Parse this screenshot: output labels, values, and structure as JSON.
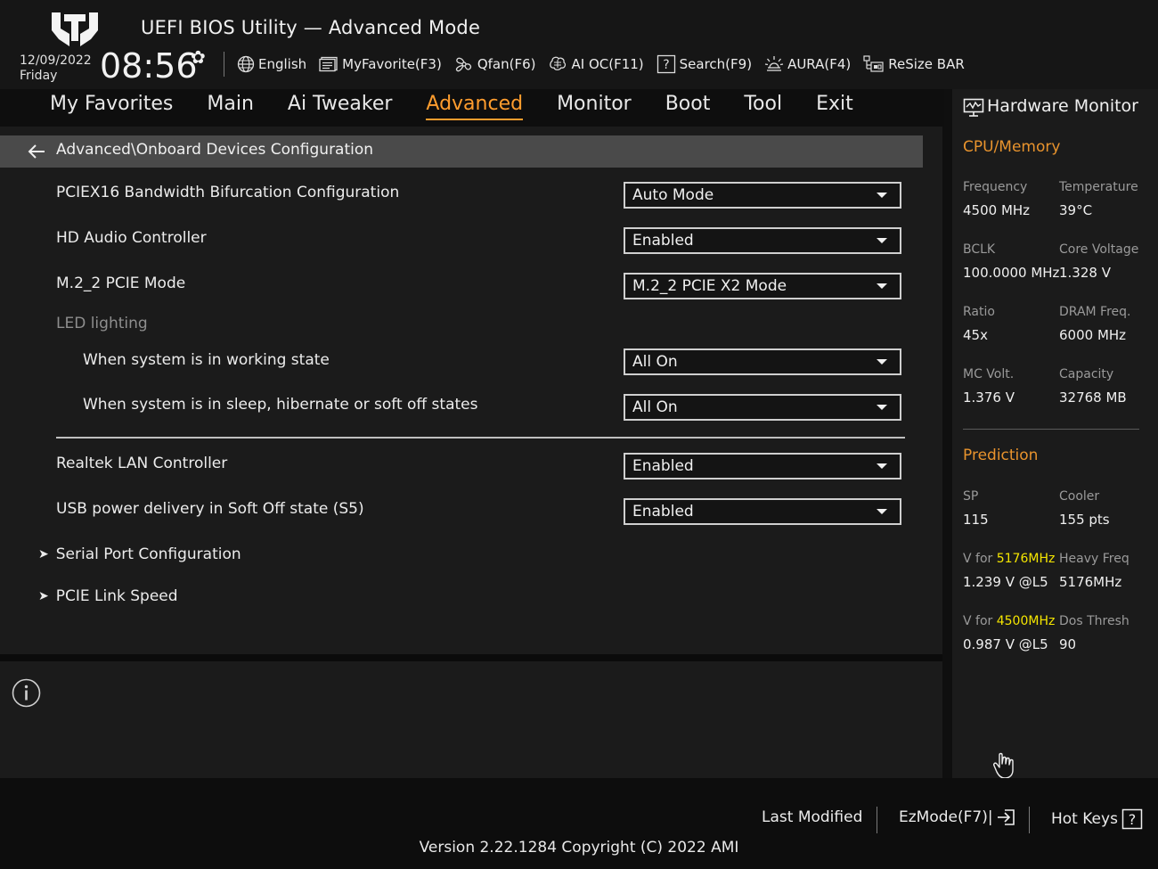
{
  "header": {
    "title": "UEFI BIOS Utility — Advanced Mode",
    "date": "12/09/2022",
    "day": "Friday",
    "time": "08:56",
    "toolbar": [
      {
        "label": "English",
        "icon": "globe-icon"
      },
      {
        "label": "MyFavorite(F3)",
        "icon": "favorite-list-icon"
      },
      {
        "label": "Qfan(F6)",
        "icon": "fan-icon"
      },
      {
        "label": "AI OC(F11)",
        "icon": "ai-chip-icon"
      },
      {
        "label": "Search(F9)",
        "icon": "search-help-icon"
      },
      {
        "label": "AURA(F4)",
        "icon": "aura-light-icon"
      },
      {
        "label": "ReSize BAR",
        "icon": "resize-bar-icon"
      }
    ]
  },
  "tabs": [
    "My Favorites",
    "Main",
    "Ai Tweaker",
    "Advanced",
    "Monitor",
    "Boot",
    "Tool",
    "Exit"
  ],
  "active_tab": "Advanced",
  "breadcrumb": "Advanced\\Onboard Devices Configuration",
  "settings": [
    {
      "label": "PCIEX16 Bandwidth Bifurcation Configuration",
      "value": "Auto Mode"
    },
    {
      "label": "HD Audio Controller",
      "value": "Enabled"
    },
    {
      "label": "M.2_2 PCIE Mode",
      "value": "M.2_2 PCIE X2 Mode"
    },
    {
      "label": "LED lighting"
    },
    {
      "label": "When system is in working state",
      "value": "All On"
    },
    {
      "label": "When system is in sleep, hibernate or soft off states",
      "value": "All On"
    },
    {
      "label": "Realtek LAN Controller",
      "value": "Enabled"
    },
    {
      "label": "USB power delivery in Soft Off state (S5)",
      "value": "Enabled"
    }
  ],
  "submenus": [
    "Serial Port Configuration",
    "PCIE Link Speed"
  ],
  "hw": {
    "title": "Hardware Monitor",
    "cpu_section": "CPU/Memory",
    "cpu": [
      {
        "label": "Frequency",
        "value": "4500 MHz"
      },
      {
        "label": "Temperature",
        "value": "39°C"
      },
      {
        "label": "BCLK",
        "value": "100.0000 MHz"
      },
      {
        "label": "Core Voltage",
        "value": "1.328 V"
      },
      {
        "label": "Ratio",
        "value": "45x"
      },
      {
        "label": "DRAM Freq.",
        "value": "6000 MHz"
      },
      {
        "label": "MC Volt.",
        "value": "1.376 V"
      },
      {
        "label": "Capacity",
        "value": "32768 MB"
      }
    ],
    "pred_section": "Prediction",
    "pred": [
      {
        "label": "SP",
        "value": "115"
      },
      {
        "label": "Cooler",
        "value": "155 pts"
      },
      {
        "label_pre": "V for ",
        "label_hl": "5176MHz",
        "value": "1.239 V @L5"
      },
      {
        "label": "Heavy Freq",
        "value": "5176MHz"
      },
      {
        "label_pre": "V for ",
        "label_hl": "4500MHz",
        "value": "0.987 V @L5"
      },
      {
        "label": "Dos Thresh",
        "value": "90"
      }
    ]
  },
  "footer": {
    "last_modified": "Last Modified",
    "ezmode": "EzMode(F7)|",
    "hotkeys": "Hot Keys",
    "version": "Version 2.22.1284 Copyright (C) 2022 AMI"
  },
  "colors": {
    "accent": "#ff9d2e",
    "highlight": "#f5e600"
  }
}
